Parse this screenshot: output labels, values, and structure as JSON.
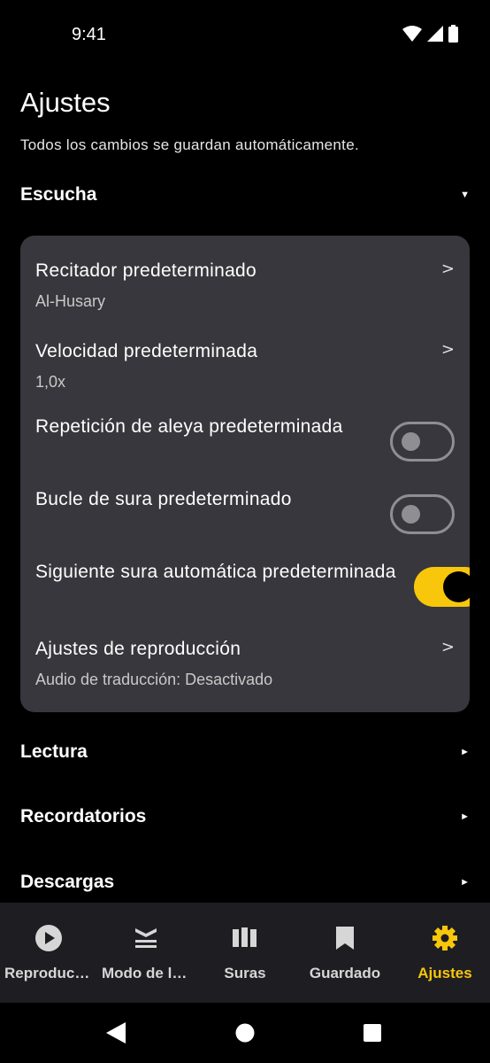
{
  "status": {
    "time": "9:41"
  },
  "page": {
    "title": "Ajustes",
    "subtitle": "Todos los cambios se guardan automáticamente."
  },
  "sections": {
    "escucha": {
      "title": "Escucha",
      "expanded": true
    },
    "lectura": {
      "title": "Lectura",
      "expanded": false
    },
    "recordatorios": {
      "title": "Recordatorios",
      "expanded": false
    },
    "descargas": {
      "title": "Descargas",
      "expanded": false
    }
  },
  "listening": {
    "reciter": {
      "title": "Recitador predeterminado",
      "value": "Al-Husary"
    },
    "speed": {
      "title": "Velocidad predeterminada",
      "value": "1,0x"
    },
    "verse_repeat": {
      "title": "Repetición de aleya predeterminada",
      "enabled": false
    },
    "surah_loop": {
      "title": "Bucle de sura predeterminado",
      "enabled": false
    },
    "auto_next": {
      "title": "Siguiente sura automática predeterminada",
      "enabled": true
    },
    "playback": {
      "title": "Ajustes de reproducción",
      "value": "Audio de traducción: Desactivado"
    }
  },
  "nav": {
    "items": [
      {
        "label": "Reproduciendo",
        "icon": "play-circle-icon"
      },
      {
        "label": "Modo de lectura",
        "icon": "book-stack-icon"
      },
      {
        "label": "Suras",
        "icon": "library-columns-icon"
      },
      {
        "label": "Guardado",
        "icon": "bookmark-icon"
      },
      {
        "label": "Ajustes",
        "icon": "gear-icon",
        "active": true
      }
    ]
  },
  "colors": {
    "accent": "#f8c70b",
    "card": "#38373d",
    "nav_bg": "#1e1e22"
  }
}
